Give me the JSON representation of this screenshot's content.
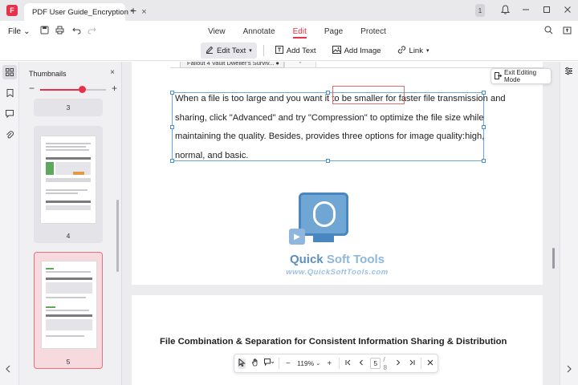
{
  "titlebar": {
    "logo": "F",
    "tab_title": "PDF User Guide_Encryption *",
    "tab_close": "×",
    "new_tab": "+",
    "badge": "1",
    "icons": [
      "bell-icon",
      "minimize-icon",
      "maximize-icon",
      "close-icon"
    ]
  },
  "menubar": {
    "file_label": "File",
    "file_caret": "⌄",
    "tabs": [
      {
        "label": "View",
        "active": false
      },
      {
        "label": "Annotate",
        "active": false
      },
      {
        "label": "Edit",
        "active": true
      },
      {
        "label": "Page",
        "active": false
      },
      {
        "label": "Protect",
        "active": false
      }
    ]
  },
  "tools": {
    "edit_text": "Edit Text",
    "add_text": "Add Text",
    "add_image": "Add Image",
    "link": "Link"
  },
  "thumbnails": {
    "header": "Thumbnails",
    "close": "×",
    "minus": "−",
    "plus": "+",
    "zoom_fraction": 0.64,
    "pages": [
      "3",
      "4",
      "5"
    ]
  },
  "document": {
    "embed_tab": "Fallout 4 Vault Dweller's Surviv... ●",
    "embed_plus": "+",
    "paragraph_lines": [
      "When a file is too large and you want it to be smaller for faster file transmission and",
      "sharing, click \"Advanced\" and try \"Compression\" to optimize the file size while",
      "maintaining the quality. Besides,  provides three options for image quality:high,",
      "normal, and basic."
    ],
    "watermark_title_a": "Quick ",
    "watermark_title_b": "Soft Tools",
    "watermark_url": "www.QuickSoftTools.com",
    "page2_heading": "File Combination & Separation for Consistent Information Sharing & Distribution"
  },
  "exit_editing": "Exit Editing Mode",
  "bottombar": {
    "zoom": "119%",
    "current_page": "5",
    "total_pages": "/ 8"
  }
}
